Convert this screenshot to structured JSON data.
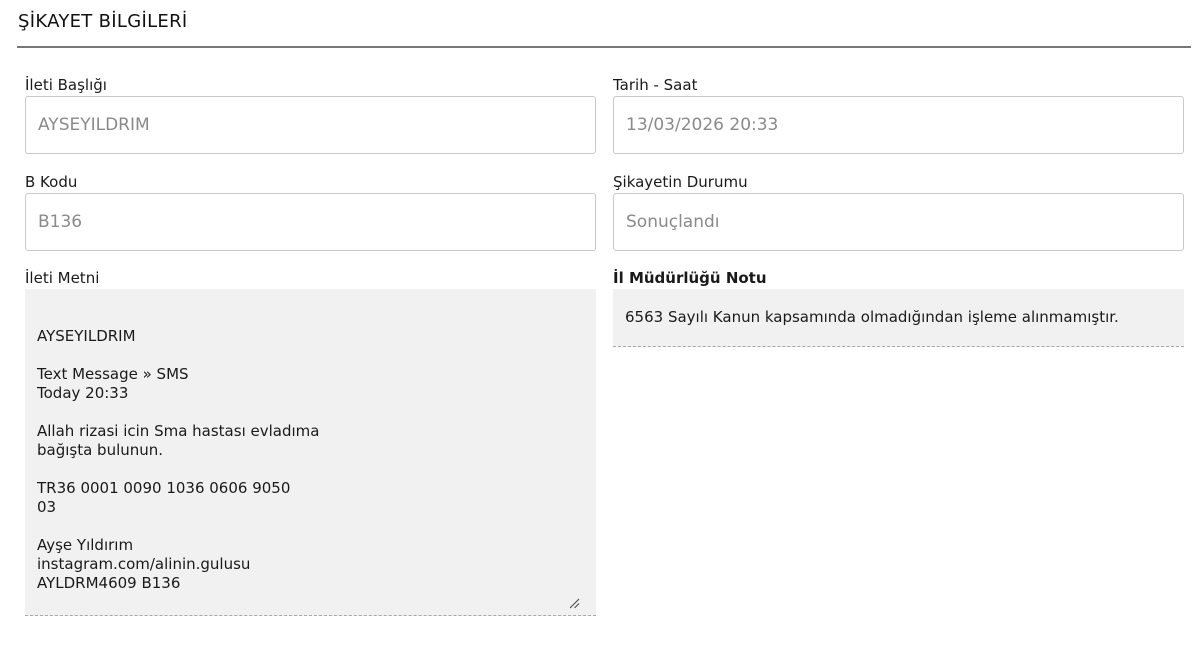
{
  "section": {
    "title": "ŞİKAYET BİLGİLERİ"
  },
  "fields": {
    "message_title": {
      "label": "İleti Başlığı",
      "value": "AYSEYILDRIM"
    },
    "date_time": {
      "label": "Tarih - Saat",
      "value": "13/03/2026 20:33"
    },
    "b_code": {
      "label": "B Kodu",
      "value": "B136"
    },
    "complaint_status": {
      "label": "Şikayetin Durumu",
      "value": "Sonuçlandı"
    },
    "message_text": {
      "label": "İleti Metni",
      "value": "AYSEYILDRIM\n\nText Message » SMS\nToday 20:33\n\nAllah rizasi icin Sma hastası evladıma\nbağışta bulunun.\n\nTR36 0001 0090 1036 0606 9050\n03\n\nAyşe Yıldırım\ninstagram.com/alinin.gulusu\nAYLDRM4609 B136"
    },
    "provincial_note": {
      "label": "İl Müdürlüğü Notu",
      "value": "6563 Sayılı Kanun kapsamında olmadığından işleme alınmamıştır."
    }
  },
  "icons": {
    "resize": "resize-handle-icon"
  },
  "colors": {
    "rule": "#777777",
    "input_border": "#c9c9c9",
    "readonly_bg": "#f1f1f1",
    "placeholder_text": "#8a8a8a"
  }
}
